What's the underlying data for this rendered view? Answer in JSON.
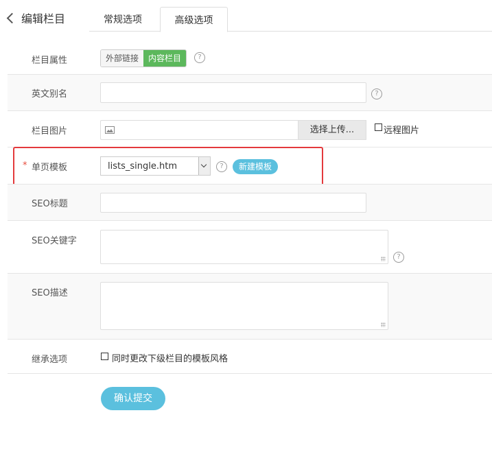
{
  "header": {
    "back_label": "编辑栏目",
    "tabs": [
      {
        "label": "常规选项",
        "active": false
      },
      {
        "label": "高级选项",
        "active": true
      }
    ]
  },
  "form": {
    "attr": {
      "label": "栏目属性",
      "options": [
        "外部链接",
        "内容栏目"
      ],
      "selected": "内容栏目",
      "help": "?"
    },
    "alias": {
      "label": "英文别名",
      "value": "",
      "help": "?"
    },
    "image": {
      "label": "栏目图片",
      "upload_button": "选择上传...",
      "remote_label": "远程图片",
      "remote_checked": false
    },
    "template": {
      "label": "单页模板",
      "required_mark": "*",
      "selected": "lists_single.htm",
      "help": "?",
      "new_button": "新建模板"
    },
    "seo_title": {
      "label": "SEO标题",
      "value": ""
    },
    "seo_keywords": {
      "label": "SEO关键字",
      "value": "",
      "help": "?"
    },
    "seo_description": {
      "label": "SEO描述",
      "value": ""
    },
    "inherit": {
      "label": "继承选项",
      "checkbox_label": "同时更改下级栏目的模板风格",
      "checked": false
    }
  },
  "submit_label": "确认提交",
  "colors": {
    "accent": "#5bc0de",
    "active_segment": "#5cb85c",
    "highlight_border": "#e4393c"
  }
}
